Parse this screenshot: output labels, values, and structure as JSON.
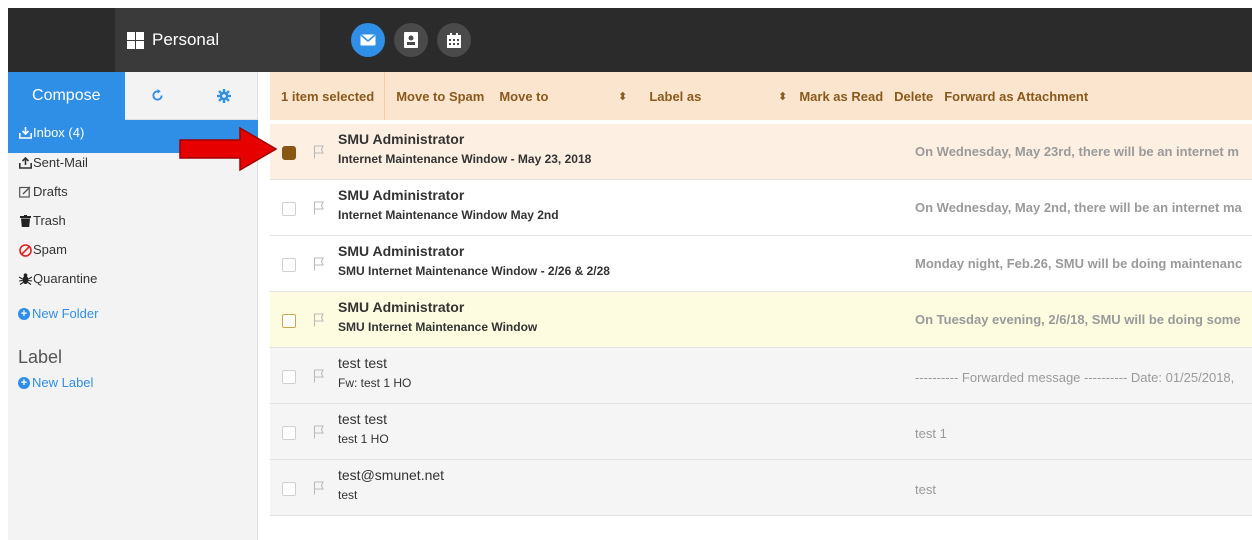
{
  "header": {
    "account_name": "Personal",
    "apps": [
      {
        "name": "mail-icon",
        "active": true
      },
      {
        "name": "contacts-icon",
        "active": false
      },
      {
        "name": "calendar-icon",
        "active": false
      }
    ]
  },
  "sidebar": {
    "compose_label": "Compose",
    "folders": [
      {
        "label": "Inbox (4)",
        "icon": "inbox-icon",
        "active": true
      },
      {
        "label": "Sent-Mail",
        "icon": "sent-icon",
        "active": false
      },
      {
        "label": "Drafts",
        "icon": "drafts-icon",
        "active": false
      },
      {
        "label": "Trash",
        "icon": "trash-icon",
        "active": false
      },
      {
        "label": "Spam",
        "icon": "spam-icon",
        "active": false
      },
      {
        "label": "Quarantine",
        "icon": "quarantine-icon",
        "active": false
      }
    ],
    "new_folder_label": "New Folder",
    "label_heading": "Label",
    "new_label_label": "New Label"
  },
  "toolbar": {
    "selected_count": "1 item selected",
    "move_to_spam": "Move to Spam",
    "move_to": "Move to",
    "label_as": "Label as",
    "mark_as_read": "Mark as Read",
    "delete": "Delete",
    "forward_as_attachment": "Forward as Attachment"
  },
  "messages": [
    {
      "sender": "SMU Administrator",
      "subject": "Internet Maintenance Window - May 23, 2018",
      "preview": "On Wednesday, May 23rd, there will be an internet m",
      "state": "selected"
    },
    {
      "sender": "SMU Administrator",
      "subject": "Internet Maintenance Window May 2nd",
      "preview": "On Wednesday, May 2nd, there will be an internet ma",
      "state": "unread"
    },
    {
      "sender": "SMU Administrator",
      "subject": "SMU Internet Maintenance Window - 2/26 & 2/28",
      "preview": "Monday night, Feb.26, SMU will be doing maintenanc",
      "state": "unread"
    },
    {
      "sender": "SMU Administrator",
      "subject": "SMU Internet Maintenance Window",
      "preview": "On Tuesday evening, 2/6/18, SMU will be doing some",
      "state": "highlight"
    },
    {
      "sender": "test test",
      "subject": "Fw: test 1 HO",
      "preview": "---------- Forwarded message ---------- Date: 01/25/2018,",
      "state": "read"
    },
    {
      "sender": "test test",
      "subject": "test 1 HO",
      "preview": "test 1",
      "state": "read"
    },
    {
      "sender": "test@smunet.net",
      "subject": "test",
      "preview": "test",
      "state": "read"
    }
  ],
  "colors": {
    "accent": "#2f8fe6",
    "toolbar_bg": "#fbe5cf",
    "toolbar_text": "#8a5a1c",
    "arrow": "#e60000"
  }
}
